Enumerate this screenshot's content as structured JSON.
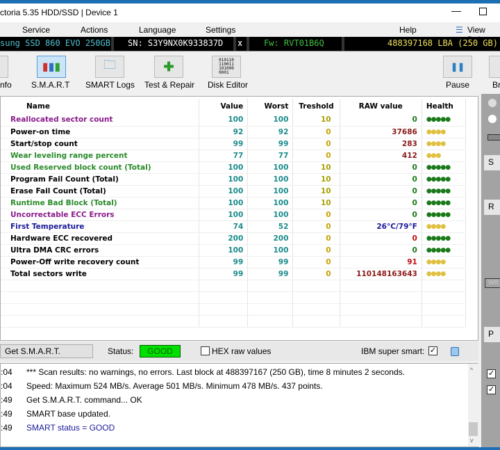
{
  "window": {
    "title": "ctoria 5.35 HDD/SSD | Device 1"
  },
  "menu": [
    "Service",
    "Actions",
    "Language",
    "Settings",
    "Help",
    "View Buf"
  ],
  "device": {
    "model": "sung SSD 860 EVO 250GB",
    "serial": "SN: S3Y9NX0K933837D",
    "close": "x",
    "firmware": "Fw: RVT01B6Q",
    "capacity": "488397168 LBA (250 GB)"
  },
  "toolbar": {
    "info": "nfo",
    "smart": "S.M.A.R.T",
    "smart_logs": "SMART Logs",
    "test_repair": "Test & Repair",
    "disk_editor": "Disk Editor",
    "pause": "Pause",
    "break": "Br"
  },
  "table": {
    "headers": [
      "Name",
      "Value",
      "Worst",
      "Treshold",
      "RAW value",
      "Health"
    ],
    "rows": [
      {
        "name": "Reallocated sector count",
        "value": "100",
        "worst": "100",
        "threshold": "10",
        "raw": "0",
        "health": 5,
        "name_color": "#8a1a8a",
        "raw_color": "#1a7a1a"
      },
      {
        "name": "Power-on time",
        "value": "92",
        "worst": "92",
        "threshold": "0",
        "raw": "37686",
        "health": 4,
        "name_color": "#000000",
        "raw_color": "#8b1a1a"
      },
      {
        "name": "Start/stop count",
        "value": "99",
        "worst": "99",
        "threshold": "0",
        "raw": "283",
        "health": 4,
        "name_color": "#000000",
        "raw_color": "#8b1a1a"
      },
      {
        "name": "Wear leveling range percent",
        "value": "77",
        "worst": "77",
        "threshold": "0",
        "raw": "412",
        "health": 3,
        "name_color": "#2a8a2a",
        "raw_color": "#8b1a1a"
      },
      {
        "name": "Used Reserved block count (Total)",
        "value": "100",
        "worst": "100",
        "threshold": "10",
        "raw": "0",
        "health": 5,
        "name_color": "#2a8a2a",
        "raw_color": "#1a7a1a"
      },
      {
        "name": "Program Fail Count (Total)",
        "value": "100",
        "worst": "100",
        "threshold": "10",
        "raw": "0",
        "health": 5,
        "name_color": "#000000",
        "raw_color": "#1a7a1a"
      },
      {
        "name": "Erase Fail Count (Total)",
        "value": "100",
        "worst": "100",
        "threshold": "10",
        "raw": "0",
        "health": 5,
        "name_color": "#000000",
        "raw_color": "#1a7a1a"
      },
      {
        "name": "Runtime Bad Block (Total)",
        "value": "100",
        "worst": "100",
        "threshold": "10",
        "raw": "0",
        "health": 5,
        "name_color": "#2a8a2a",
        "raw_color": "#1a7a1a"
      },
      {
        "name": "Uncorrectable ECC Errors",
        "value": "100",
        "worst": "100",
        "threshold": "0",
        "raw": "0",
        "health": 5,
        "name_color": "#8a1a8a",
        "raw_color": "#1a7a1a"
      },
      {
        "name": "First Temperature",
        "value": "74",
        "worst": "52",
        "threshold": "0",
        "raw": "26°C/79°F",
        "health": 4,
        "name_color": "#1a1a9a",
        "raw_color": "#1a1a9a"
      },
      {
        "name": "Hardware ECC recovered",
        "value": "200",
        "worst": "200",
        "threshold": "0",
        "raw": "0",
        "health": 5,
        "name_color": "#000000",
        "raw_color": "#c01010"
      },
      {
        "name": "Ultra DMA CRC errors",
        "value": "100",
        "worst": "100",
        "threshold": "0",
        "raw": "0",
        "health": 5,
        "name_color": "#000000",
        "raw_color": "#1a7a1a"
      },
      {
        "name": "Power-Off write recovery count",
        "value": "99",
        "worst": "99",
        "threshold": "0",
        "raw": "91",
        "health": 4,
        "name_color": "#000000",
        "raw_color": "#c01010"
      },
      {
        "name": "Total sectors write",
        "value": "99",
        "worst": "99",
        "threshold": "0",
        "raw": "110148163643",
        "health": 4,
        "name_color": "#000000",
        "raw_color": "#8b1a1a"
      }
    ]
  },
  "status": {
    "get_smart": "Get S.M.A.R.T.",
    "status_label": "Status:",
    "status_value": "GOOD",
    "hex_label": "HEX raw values",
    "hex_checked": false,
    "ibm_label": "IBM super smart:",
    "ibm_checked": true,
    "good_color": "#00e000"
  },
  "log": [
    {
      "time": ":04",
      "text": "*** Scan results: no warnings, no errors. Last block at 488397167 (250 GB), time 8 minutes 2 seconds.",
      "color": "#000000"
    },
    {
      "time": ":04",
      "text": "Speed: Maximum 524 MB/s. Average 501 MB/s. Minimum 478 MB/s. 437 points.",
      "color": "#000000"
    },
    {
      "time": ":49",
      "text": "Get S.M.A.R.T. command... OK",
      "color": "#000000"
    },
    {
      "time": ":49",
      "text": "SMART base updated.",
      "color": "#000000"
    },
    {
      "time": ":49",
      "text": "SMART status = GOOD",
      "color": "#1a1a9a"
    }
  ],
  "right_panel": {
    "buttons": [
      "S",
      "R",
      "P"
    ],
    "wr": "WR"
  }
}
